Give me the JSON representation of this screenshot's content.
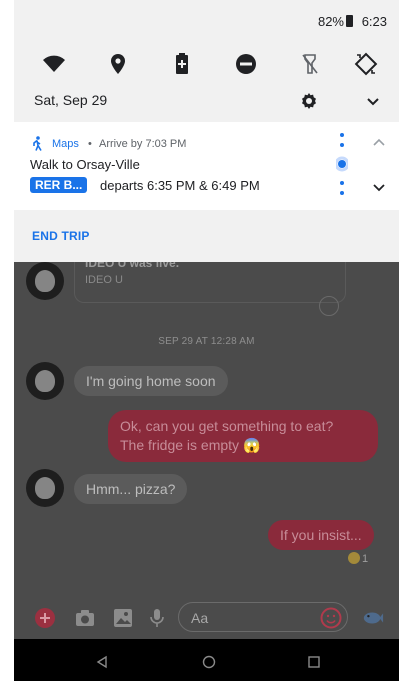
{
  "status_bar": {
    "battery_percent": "82%",
    "time": "6:23"
  },
  "quick_settings": {
    "icons": [
      "wifi-icon",
      "location-icon",
      "battery-saver-icon",
      "do-not-disturb-icon",
      "flashlight-icon",
      "auto-rotate-icon"
    ]
  },
  "date_row": {
    "date": "Sat, Sep 29"
  },
  "notification": {
    "app": "Maps",
    "separator": "•",
    "arrive": "Arrive by 7:03 PM",
    "title": "Walk to Orsay-Ville",
    "badge": "RER B...",
    "departs": "departs  6:35 PM & 6:49 PM",
    "action": "END TRIP",
    "accent_color": "#1a73e8"
  },
  "chat": {
    "preview_line1": "IDEO U was live.",
    "preview_line2": "IDEO U",
    "date_separator": "SEP 29 AT 12:28 AM",
    "messages": [
      {
        "from": "them",
        "text": "I'm going home soon"
      },
      {
        "from": "me",
        "text_line1": "Ok, can you get something to eat?",
        "text_line2": "The fridge is empty 😱"
      },
      {
        "from": "them",
        "text": "Hmm... pizza?"
      },
      {
        "from": "me",
        "text": "If you insist..."
      }
    ],
    "reaction_count": "1",
    "input_placeholder": "Aa"
  }
}
